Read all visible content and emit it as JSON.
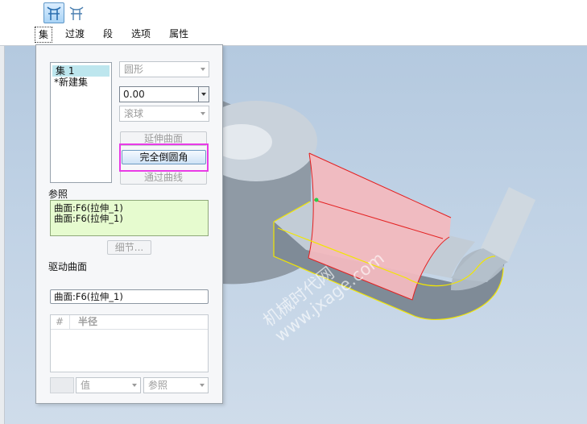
{
  "toolbar": {
    "tool1_icon": "set-mode-icon",
    "tool2_icon": "transition-mode-icon",
    "tabs": [
      "集",
      "过渡",
      "段",
      "选项",
      "属性"
    ]
  },
  "panel": {
    "sets": [
      "集 1",
      "*新建集"
    ],
    "shape_dropdown": "圆形",
    "radius_value": "0.00",
    "method_dropdown": "滚球",
    "extend_surface_button": "延伸曲面",
    "full_round_button": "完全倒圆角",
    "through_curve_button": "通过曲线",
    "references_label": "参照",
    "references": [
      "曲面:F6(拉伸_1)",
      "曲面:F6(拉伸_1)"
    ],
    "details_button": "细节...",
    "drive_surface_label": "驱动曲面",
    "drive_surface_value": "曲面:F6(拉伸_1)",
    "radius_table": {
      "col_index": "#",
      "col_radius": "半径"
    },
    "value_dropdown": "值",
    "reference_dropdown": "参照"
  },
  "watermark": {
    "line1": "机械时代网",
    "line2": "www.jxage.com"
  },
  "colors": {
    "highlight": "#e93be6",
    "reference_bg": "#e6fbcf",
    "selection_bg": "#bde6ee",
    "viewport_bg": "#c0d2e5",
    "surface_selected": "#f2b9bf",
    "edge_yellow": "#f2e600",
    "edge_red": "#e42020"
  }
}
